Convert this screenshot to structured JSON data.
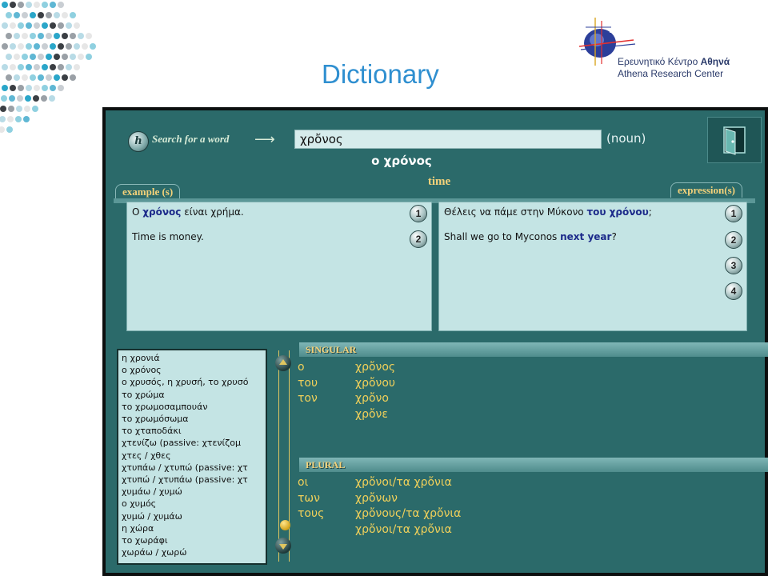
{
  "slide": {
    "title": "Dictionary",
    "logo": {
      "line1_prefix": "Ερευνητικό Κέντρο ",
      "line1_bold": "Αθηνά",
      "line2_prefix": "Athena ",
      "line2_rest": "Research Center"
    }
  },
  "app": {
    "help_label": "h",
    "search_label": "Search for a word",
    "search_value": "χρὄνος",
    "part_of_speech": "(noun)",
    "headword": "ο χρόνος",
    "translation": "time",
    "examples_tab": "example (s)",
    "expressions_tab": "expression(s)",
    "examples": {
      "greek_pre": "Ο ",
      "greek_hl": "χρόνος",
      "greek_post": " είναι χρήμα.",
      "english": "Time is money.",
      "buttons": [
        "1",
        "2"
      ]
    },
    "expressions": {
      "greek_pre": "Θέλεις να πάμε στην Μύκονο ",
      "greek_hl": "του χρόνου",
      "greek_post": ";",
      "english_pre": "Shall we go to Myconos ",
      "english_hl": "next year",
      "english_post": "?",
      "buttons": [
        "1",
        "2",
        "3",
        "4"
      ]
    },
    "word_list": [
      "η χρονιά",
      "ο χρόνος",
      "ο χρυσός, η χρυσή, το χρυσό",
      "το χρώμα",
      "το χρωμοσαμπουάν",
      "το χρωμόσωμα",
      "το χταποδάκι",
      "χτενίζω (passive: χτενίζομ",
      "χτες / χθες",
      "χτυπάω / χτυπώ (passive: χτ",
      "χτυπώ / χτυπάω (passive: χτ",
      "χυμάω / χυμώ",
      "ο χυμός",
      "χυμώ / χυμάω",
      "η χώρα",
      "το χωράφι",
      "χωράω / χωρώ"
    ],
    "singular": {
      "label": "SINGULAR",
      "rows": [
        {
          "art": "ο",
          "form": "χρὄνος"
        },
        {
          "art": "του",
          "form": "χρὄνου"
        },
        {
          "art": "τον",
          "form": "χρὄνο"
        },
        {
          "art": "",
          "form": "χρὄνε"
        }
      ]
    },
    "plural": {
      "label": "PLURAL",
      "rows": [
        {
          "art": "οι",
          "form": "χρὄνοι/τα χρὄνια"
        },
        {
          "art": "των",
          "form": "χρὄνων"
        },
        {
          "art": "τους",
          "form": "χρὄνους/τα χρὄνια"
        },
        {
          "art": "",
          "form": "χρὄνοι/τα χρὄνια"
        }
      ]
    }
  }
}
